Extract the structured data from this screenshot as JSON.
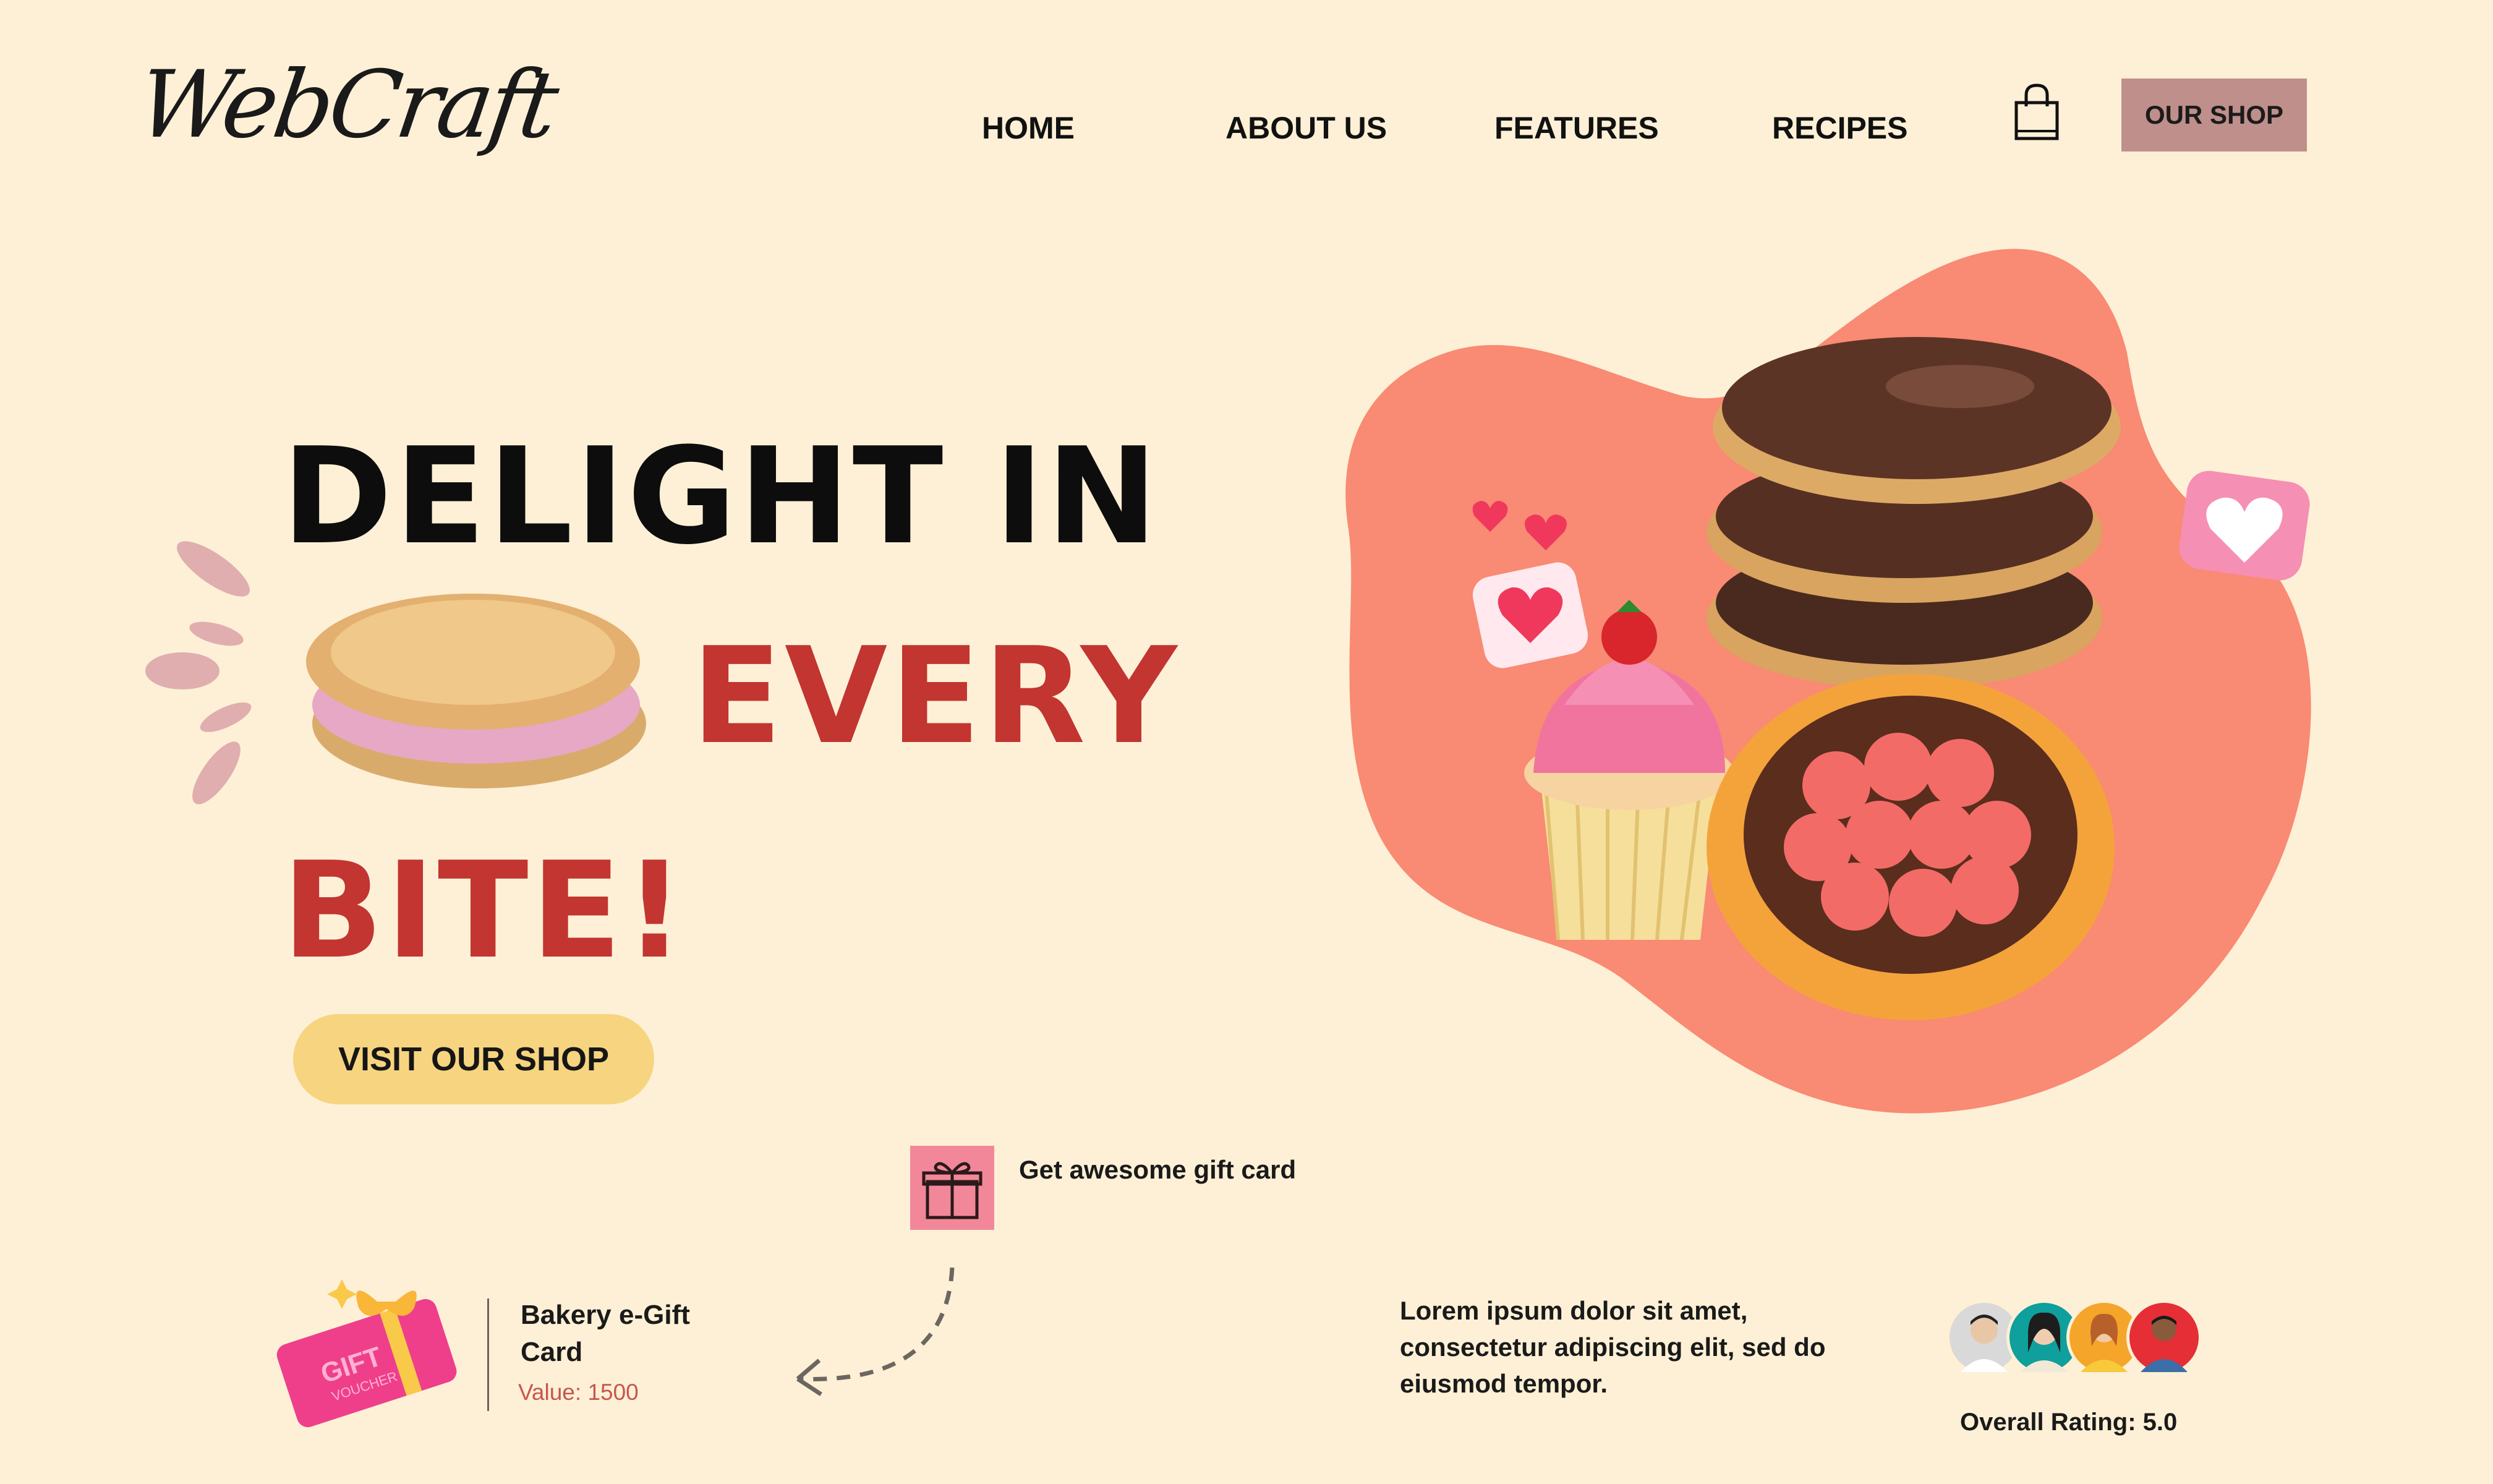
{
  "brand": {
    "logo_text": "WebCraft"
  },
  "nav": {
    "items": [
      {
        "label": "HOME"
      },
      {
        "label": "ABOUT US"
      },
      {
        "label": "FEATURES"
      },
      {
        "label": "RECIPES"
      }
    ],
    "cart_icon": "shopping-bag-icon",
    "shop_button": "OUR SHOP"
  },
  "hero": {
    "line1": "DELIGHT IN",
    "line2": "EVERY",
    "line3": "BITE!",
    "cta": "VISIT OUR SHOP"
  },
  "gift_card_promo": {
    "icon": "gift-icon",
    "title": "Get awesome gift card"
  },
  "ecard": {
    "voucher_text": "GIFT",
    "voucher_subtext": "VOUCHER",
    "name": "Bakery e-Gift Card",
    "value": "Value: 1500"
  },
  "testimonial": {
    "text": "Lorem ipsum dolor sit amet, consectetur adipiscing elit, sed do eiusmod tempor.",
    "rating": "Overall Rating: 5.0"
  },
  "colors": {
    "background": "#fdf0d6",
    "accent_red": "#c23530",
    "blob": "#f98a73",
    "button_yellow": "#f7d47f",
    "shop_button": "#bf8f8b",
    "gift_box": "#f3879a"
  }
}
